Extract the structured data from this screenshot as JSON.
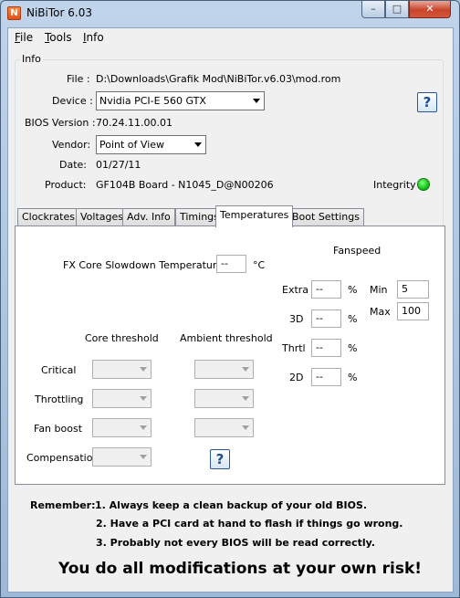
{
  "window": {
    "title": "NiBiTor 6.03",
    "min_glyph": "–",
    "max_glyph": "□",
    "close_glyph": "✕",
    "icon_letter": "N"
  },
  "menu": {
    "file": "File",
    "tools": "Tools",
    "info": "Info"
  },
  "info": {
    "group_title": "Info",
    "file_label": "File :",
    "file_value": "D:\\Downloads\\Grafik Mod\\NiBiTor.v6.03\\mod.rom",
    "device_label": "Device :",
    "device_value": "Nvidia PCI-E 560 GTX",
    "bios_version_label": "BIOS Version :",
    "bios_version_value": "70.24.11.00.01",
    "vendor_label": "Vendor:",
    "vendor_value": "Point of View",
    "date_label": "Date:",
    "date_value": "01/27/11",
    "product_label": "Product:",
    "product_value": "GF104B Board - N1045_D@N00206",
    "integrity_label": "Integrity :",
    "integrity_status_color": "#22cc22",
    "help_glyph": "?"
  },
  "tabs": [
    "Clockrates",
    "Voltages",
    "Adv. Info",
    "Timings",
    "Temperatures",
    "Boot Settings"
  ],
  "active_tab": "Temperatures",
  "temperatures": {
    "fx_label": "FX Core Slowdown Temperature :",
    "fx_value": "--",
    "fx_unit": "°C",
    "fanspeed_title": "Fanspeed",
    "fan_rows": [
      {
        "label": "Extra",
        "value": "--",
        "unit": "%"
      },
      {
        "label": "3D",
        "value": "--",
        "unit": "%"
      },
      {
        "label": "Thrtl",
        "value": "--",
        "unit": "%"
      },
      {
        "label": "2D",
        "value": "--",
        "unit": "%"
      }
    ],
    "min_label": "Min",
    "min_value": "5",
    "max_label": "Max",
    "max_value": "100",
    "core_threshold_header": "Core threshold",
    "ambient_threshold_header": "Ambient threshold",
    "threshold_rows": [
      "Critical",
      "Throttling",
      "Fan boost",
      "Compensation"
    ],
    "help_glyph": "?"
  },
  "footer": {
    "remember_label": "Remember:",
    "line1": "1. Always keep a clean backup of your old BIOS.",
    "line2": "2. Have a PCI card at hand to flash if things go wrong.",
    "line3": "3. Probably not every BIOS will be read correctly.",
    "warning": "You do all modifications at your own risk!"
  }
}
